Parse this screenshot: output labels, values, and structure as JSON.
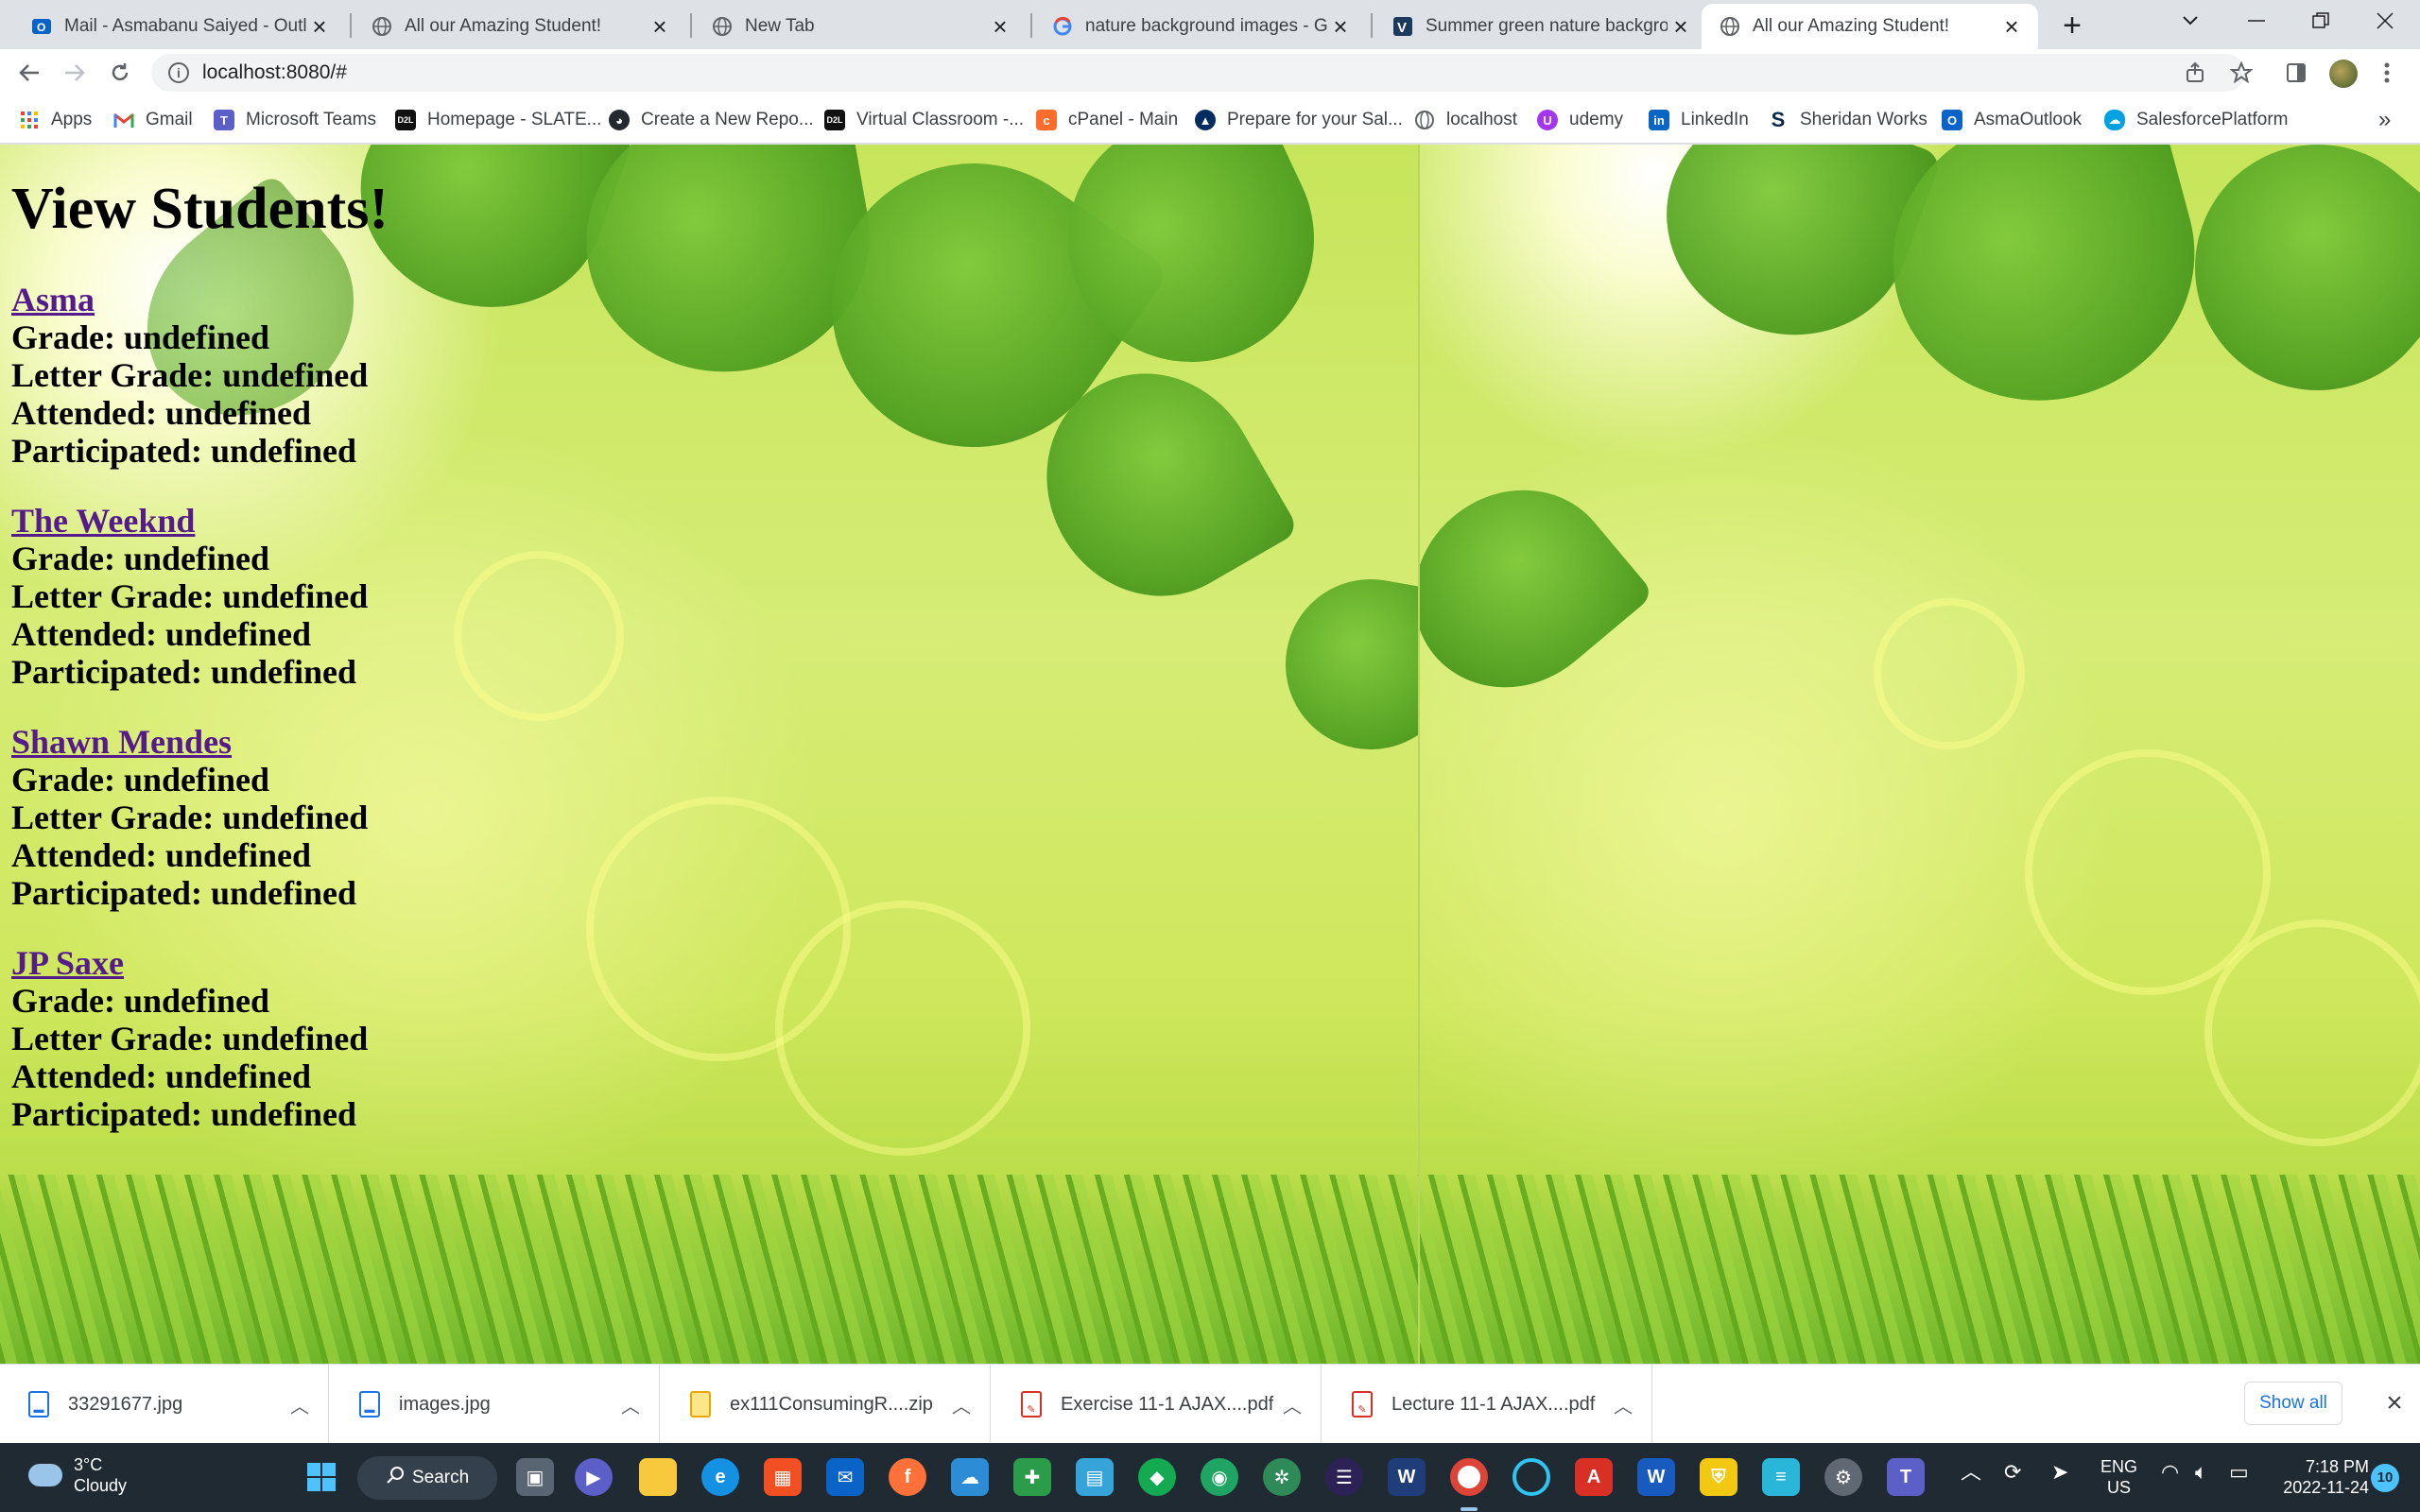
{
  "browser": {
    "tabs": [
      {
        "title": "Mail - Asmabanu Saiyed - Outlook",
        "favicon": "outlook-icon",
        "active": false
      },
      {
        "title": "All our Amazing Student!",
        "favicon": "globe-icon",
        "active": false
      },
      {
        "title": "New Tab",
        "favicon": "globe-icon",
        "active": false
      },
      {
        "title": "nature background images - Google",
        "favicon": "google-icon",
        "active": false
      },
      {
        "title": "Summer green nature background",
        "favicon": "vecteezy-icon",
        "active": false
      },
      {
        "title": "All our Amazing Student!",
        "favicon": "globe-icon",
        "active": true
      }
    ],
    "url": "localhost:8080/#",
    "bookmarks": [
      {
        "label": "Apps",
        "icon": "apps-grid-icon"
      },
      {
        "label": "Gmail",
        "icon": "gmail-icon"
      },
      {
        "label": "Microsoft Teams",
        "icon": "teams-icon"
      },
      {
        "label": "Homepage - SLATE...",
        "icon": "d2l-icon"
      },
      {
        "label": "Create a New Repo...",
        "icon": "github-icon"
      },
      {
        "label": "Virtual Classroom -...",
        "icon": "d2l-icon"
      },
      {
        "label": "cPanel - Main",
        "icon": "cpanel-icon"
      },
      {
        "label": "Prepare for your Sal...",
        "icon": "trailhead-icon"
      },
      {
        "label": "localhost",
        "icon": "globe-icon"
      },
      {
        "label": "udemy",
        "icon": "udemy-icon"
      },
      {
        "label": "LinkedIn",
        "icon": "linkedin-icon"
      },
      {
        "label": "Sheridan Works",
        "icon": "sheridan-icon"
      },
      {
        "label": "AsmaOutlook",
        "icon": "outlook-icon"
      },
      {
        "label": "SalesforcePlatform",
        "icon": "salesforce-icon"
      }
    ],
    "more_bookmarks": "»"
  },
  "page": {
    "heading": "View Students!",
    "students": [
      {
        "name": "Asma",
        "grade": "Grade: undefined",
        "letter": "Letter Grade: undefined",
        "attended": "Attended: undefined",
        "participated": "Participated: undefined"
      },
      {
        "name": "The Weeknd",
        "grade": "Grade: undefined",
        "letter": "Letter Grade: undefined",
        "attended": "Attended: undefined",
        "participated": "Participated: undefined"
      },
      {
        "name": "Shawn Mendes",
        "grade": "Grade: undefined",
        "letter": "Letter Grade: undefined",
        "attended": "Attended: undefined",
        "participated": "Participated: undefined"
      },
      {
        "name": "JP Saxe",
        "grade": "Grade: undefined",
        "letter": "Letter Grade: undefined",
        "attended": "Attended: undefined",
        "participated": "Participated: undefined"
      }
    ]
  },
  "downloads": {
    "items": [
      {
        "name": "33291677.jpg",
        "type": "image"
      },
      {
        "name": "images.jpg",
        "type": "image"
      },
      {
        "name": "ex111ConsumingR....zip",
        "type": "zip"
      },
      {
        "name": "Exercise 11-1 AJAX....pdf",
        "type": "pdf"
      },
      {
        "name": "Lecture 11-1 AJAX....pdf",
        "type": "pdf"
      }
    ],
    "show_all": "Show all"
  },
  "taskbar": {
    "weather_temp": "3°C",
    "weather_desc": "Cloudy",
    "search": "Search",
    "lang_top": "ENG",
    "lang_bottom": "US",
    "time": "7:18 PM",
    "date": "2022-11-24",
    "notifications": "10"
  },
  "colors": {
    "visited_link": "#551a8b",
    "tab_strip": "#dee1e6",
    "taskbar": "#1f2a33",
    "accent": "#1a73e8"
  }
}
